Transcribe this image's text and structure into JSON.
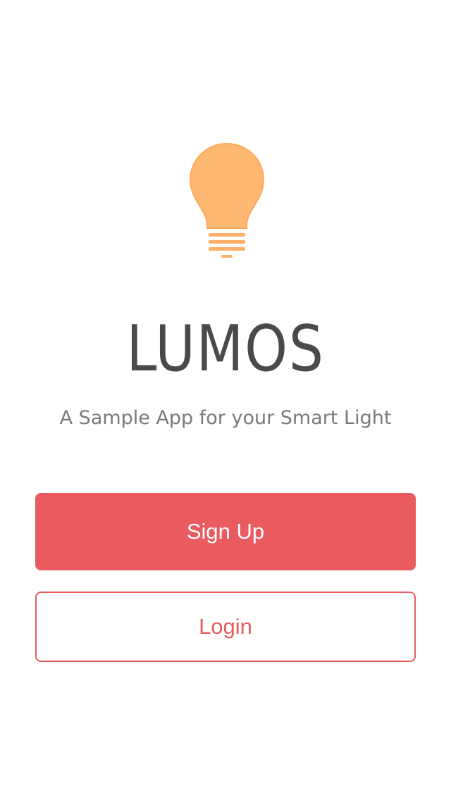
{
  "app": {
    "title": "LUMOS",
    "tagline": "A Sample App for your Smart Light",
    "logo_icon": "lightbulb-icon"
  },
  "actions": {
    "signup_label": "Sign Up",
    "login_label": "Login"
  },
  "colors": {
    "accent": "#e95b5f",
    "bulb": "#ffb872",
    "title_text": "#4a4a4a",
    "subtitle_text": "#7a7a7a",
    "background": "#ffffff"
  }
}
